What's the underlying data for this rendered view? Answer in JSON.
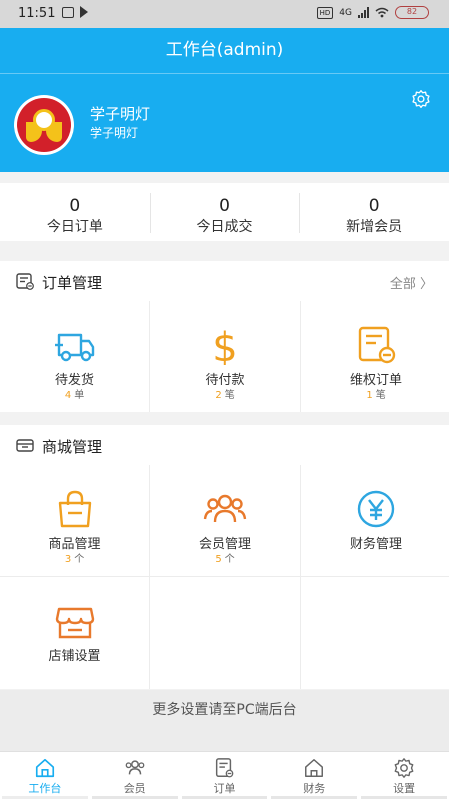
{
  "status_bar": {
    "time": "11:51",
    "network": "4G",
    "battery": "82"
  },
  "header": {
    "title": "工作台(admin)"
  },
  "profile": {
    "name": "学子明灯",
    "subtitle": "学子明灯"
  },
  "stats": [
    {
      "value": "0",
      "label": "今日订单"
    },
    {
      "value": "0",
      "label": "今日成交"
    },
    {
      "value": "0",
      "label": "新增会员"
    }
  ],
  "orders": {
    "title": "订单管理",
    "more": "全部 〉",
    "items": [
      {
        "label": "待发货",
        "count": "4",
        "unit": "单",
        "icon": "truck-icon"
      },
      {
        "label": "待付款",
        "count": "2",
        "unit": "笔",
        "icon": "dollar-icon"
      },
      {
        "label": "维权订单",
        "count": "1",
        "unit": "笔",
        "icon": "refund-order-icon"
      }
    ]
  },
  "mall": {
    "title": "商城管理",
    "items": [
      {
        "label": "商品管理",
        "count": "3",
        "unit": "个",
        "icon": "shopping-bag-icon"
      },
      {
        "label": "会员管理",
        "count": "5",
        "unit": "个",
        "icon": "members-icon"
      },
      {
        "label": "财务管理",
        "icon": "yen-icon"
      },
      {
        "label": "店铺设置",
        "icon": "store-icon"
      }
    ]
  },
  "footer_note": "更多设置请至PC端后台",
  "tabs": [
    {
      "label": "工作台",
      "icon": "home-icon",
      "active": true
    },
    {
      "label": "会员",
      "icon": "members-icon"
    },
    {
      "label": "订单",
      "icon": "order-icon"
    },
    {
      "label": "财务",
      "icon": "finance-icon"
    },
    {
      "label": "设置",
      "icon": "gear-icon"
    }
  ],
  "colors": {
    "primary": "#18adf0",
    "accent": "#f0a020",
    "badge": "#d2202a"
  }
}
